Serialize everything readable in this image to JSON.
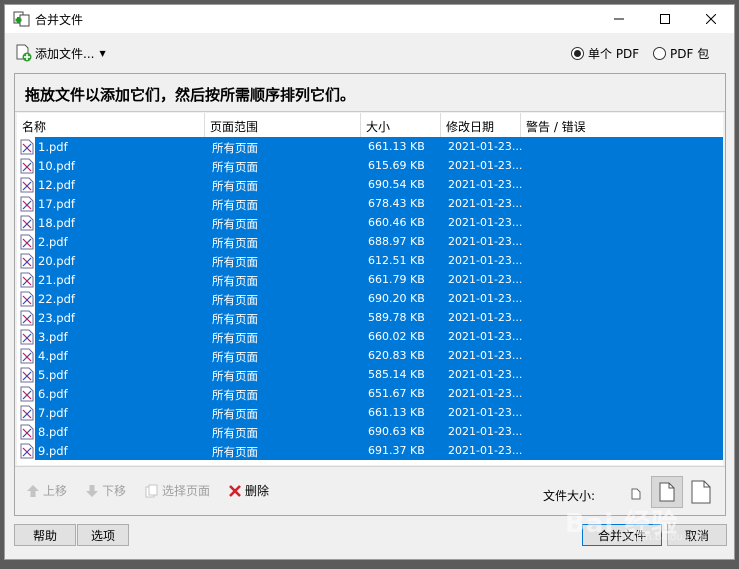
{
  "window": {
    "title": "合并文件",
    "icon": "merge-app-icon"
  },
  "toolbar": {
    "add_files_label": "添加文件...",
    "output_options": [
      {
        "label": "单个 PDF",
        "checked": true
      },
      {
        "label": "PDF 包",
        "checked": false
      }
    ]
  },
  "panel": {
    "hint": "拖放文件以添加它们，然后按所需顺序排列它们。",
    "columns": [
      "名称",
      "页面范围",
      "大小",
      "修改日期",
      "警告 / 错误"
    ],
    "rows": [
      {
        "name": "1.pdf",
        "range": "所有页面",
        "size": "661.13 KB",
        "date": "2021-01-23...",
        "warning": ""
      },
      {
        "name": "10.pdf",
        "range": "所有页面",
        "size": "615.69 KB",
        "date": "2021-01-23...",
        "warning": ""
      },
      {
        "name": "12.pdf",
        "range": "所有页面",
        "size": "690.54 KB",
        "date": "2021-01-23...",
        "warning": ""
      },
      {
        "name": "17.pdf",
        "range": "所有页面",
        "size": "678.43 KB",
        "date": "2021-01-23...",
        "warning": ""
      },
      {
        "name": "18.pdf",
        "range": "所有页面",
        "size": "660.46 KB",
        "date": "2021-01-23...",
        "warning": ""
      },
      {
        "name": "2.pdf",
        "range": "所有页面",
        "size": "688.97 KB",
        "date": "2021-01-23...",
        "warning": ""
      },
      {
        "name": "20.pdf",
        "range": "所有页面",
        "size": "612.51 KB",
        "date": "2021-01-23...",
        "warning": ""
      },
      {
        "name": "21.pdf",
        "range": "所有页面",
        "size": "661.79 KB",
        "date": "2021-01-23...",
        "warning": ""
      },
      {
        "name": "22.pdf",
        "range": "所有页面",
        "size": "690.20 KB",
        "date": "2021-01-23...",
        "warning": ""
      },
      {
        "name": "23.pdf",
        "range": "所有页面",
        "size": "589.78 KB",
        "date": "2021-01-23...",
        "warning": ""
      },
      {
        "name": "3.pdf",
        "range": "所有页面",
        "size": "660.02 KB",
        "date": "2021-01-23...",
        "warning": ""
      },
      {
        "name": "4.pdf",
        "range": "所有页面",
        "size": "620.83 KB",
        "date": "2021-01-23...",
        "warning": ""
      },
      {
        "name": "5.pdf",
        "range": "所有页面",
        "size": "585.14 KB",
        "date": "2021-01-23...",
        "warning": ""
      },
      {
        "name": "6.pdf",
        "range": "所有页面",
        "size": "651.67 KB",
        "date": "2021-01-23...",
        "warning": ""
      },
      {
        "name": "7.pdf",
        "range": "所有页面",
        "size": "661.13 KB",
        "date": "2021-01-23...",
        "warning": ""
      },
      {
        "name": "8.pdf",
        "range": "所有页面",
        "size": "690.63 KB",
        "date": "2021-01-23...",
        "warning": ""
      },
      {
        "name": "9.pdf",
        "range": "所有页面",
        "size": "691.37 KB",
        "date": "2021-01-23...",
        "warning": ""
      }
    ]
  },
  "bottom_bar": {
    "move_up": "上移",
    "move_down": "下移",
    "select_pages": "选择页面",
    "delete": "删除",
    "file_size_label": "文件大小:"
  },
  "buttons": {
    "help": "帮助",
    "options": "选项",
    "merge": "合并文件",
    "cancel": "取消"
  },
  "watermark": {
    "text": "Bai 经验",
    "sub": "jingyan.baidu.com"
  },
  "colors": {
    "selection": "#0078d7",
    "window_bg": "#f0f0f0"
  }
}
